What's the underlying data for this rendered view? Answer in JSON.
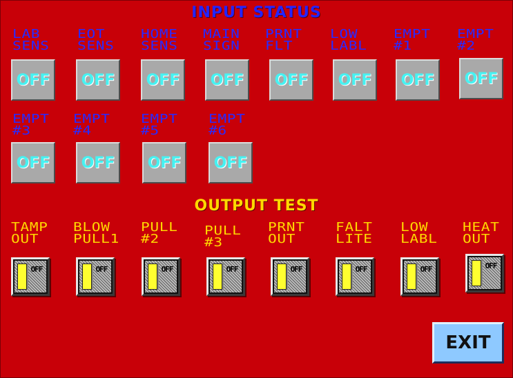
{
  "input_status": {
    "title": "INPUT STATUS",
    "items": [
      {
        "label": "LAB\nSENS",
        "value": "OFF"
      },
      {
        "label": "EOT\nSENS",
        "value": "OFF"
      },
      {
        "label": "HOME\nSENS",
        "value": "OFF"
      },
      {
        "label": "MAIN\nSIGN",
        "value": "OFF"
      },
      {
        "label": "PRNT\nFLT",
        "value": "OFF"
      },
      {
        "label": "LOW\nLABL",
        "value": "OFF"
      },
      {
        "label": "EMPT\n#1",
        "value": "OFF"
      },
      {
        "label": "EMPT\n#2",
        "value": "OFF"
      },
      {
        "label": "EMPT\n#3",
        "value": "OFF"
      },
      {
        "label": "EMPT\n#4",
        "value": "OFF"
      },
      {
        "label": "EMPT\n#5",
        "value": "OFF"
      },
      {
        "label": "EMPT\n#6",
        "value": "OFF"
      }
    ]
  },
  "output_test": {
    "title": "OUTPUT TEST",
    "items": [
      {
        "label": "TAMP\nOUT",
        "state": "OFF"
      },
      {
        "label": "BLOW\nPULL1",
        "state": "OFF"
      },
      {
        "label": "PULL\n#2",
        "state": "OFF"
      },
      {
        "label": "PULL\n#3",
        "state": "OFF"
      },
      {
        "label": "PRNT\nOUT",
        "state": "OFF"
      },
      {
        "label": "FALT\nLITE",
        "state": "OFF"
      },
      {
        "label": "LOW\nLABL",
        "state": "OFF"
      },
      {
        "label": "HEAT\nOUT",
        "state": "OFF"
      }
    ]
  },
  "exit_label": "EXIT",
  "colors": {
    "background": "#c80008",
    "input_label": "#2a2aff",
    "output_label": "#ffd800",
    "status_text": "#46f2f2",
    "status_button": "#a9a9a9",
    "exit_button": "#8ec9ff",
    "toggle_lever": "#ffff30"
  }
}
